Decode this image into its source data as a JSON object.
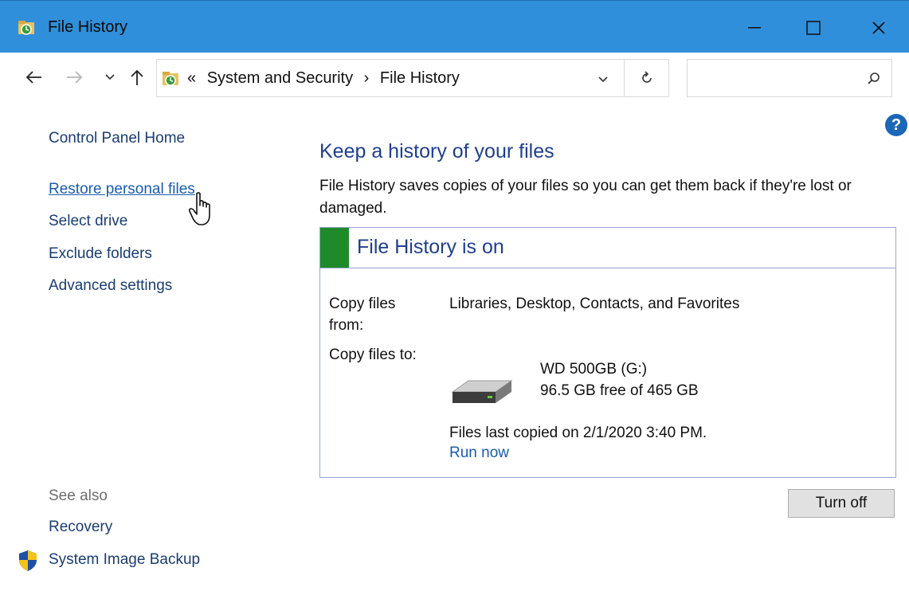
{
  "window": {
    "title": "File History"
  },
  "address": {
    "overflow": "«",
    "crumbs": [
      "System and Security",
      "File History"
    ],
    "separator": "›"
  },
  "search": {
    "placeholder": ""
  },
  "sidebar": {
    "home": "Control Panel Home",
    "items": [
      "Restore personal files",
      "Select drive",
      "Exclude folders",
      "Advanced settings"
    ],
    "see_also_label": "See also",
    "see_also": [
      "Recovery",
      "System Image Backup"
    ]
  },
  "main": {
    "heading": "Keep a history of your files",
    "description": "File History saves copies of your files so you can get them back if they're lost or damaged.",
    "status_title": "File History is on",
    "copy_from_label": "Copy files from:",
    "copy_from_value": "Libraries, Desktop, Contacts, and Favorites",
    "copy_to_label": "Copy files to:",
    "drive_name": "WD 500GB (G:)",
    "drive_space": "96.5 GB free of 465 GB",
    "last_copied": "Files last copied on 2/1/2020 3:40 PM.",
    "run_now": "Run now",
    "turn_off": "Turn off"
  },
  "icons": {
    "help": "?"
  },
  "colors": {
    "titlebar": "#2f8fdb",
    "status_on": "#1f8a2a",
    "link": "#1a5cad",
    "heading": "#1f3f8f"
  }
}
